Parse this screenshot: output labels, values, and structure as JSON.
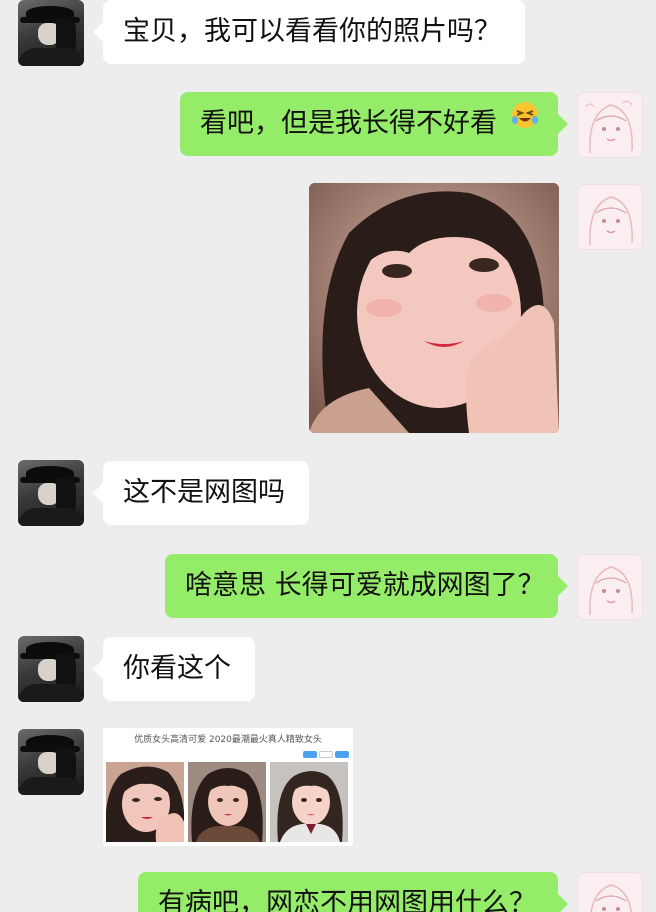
{
  "messages": [
    {
      "side": "left",
      "text": "宝贝，我可以看看你的照片吗？"
    },
    {
      "side": "right",
      "text": "看吧，但是我长得不好看",
      "emoji": "laughing-crying-emoji"
    },
    {
      "side": "right",
      "type": "photo",
      "content": "selfie-photo"
    },
    {
      "side": "left",
      "text": "这不是网图吗"
    },
    {
      "side": "right",
      "text": "啥意思 长得可爱就成网图了？"
    },
    {
      "side": "left",
      "text": "你看这个"
    },
    {
      "side": "left",
      "type": "screenshot",
      "title": "优质女头高清可爱 2020最潮最火真人精致女头"
    },
    {
      "side": "right",
      "text": "有病吧，网恋不用网图用什么？"
    }
  ],
  "colors": {
    "background": "#ededed",
    "incoming_bubble": "#ffffff",
    "outgoing_bubble": "#95ec69"
  },
  "icons": {
    "male_avatar": "avatar-icon",
    "female_avatar": "anime-girl-avatar-icon"
  }
}
